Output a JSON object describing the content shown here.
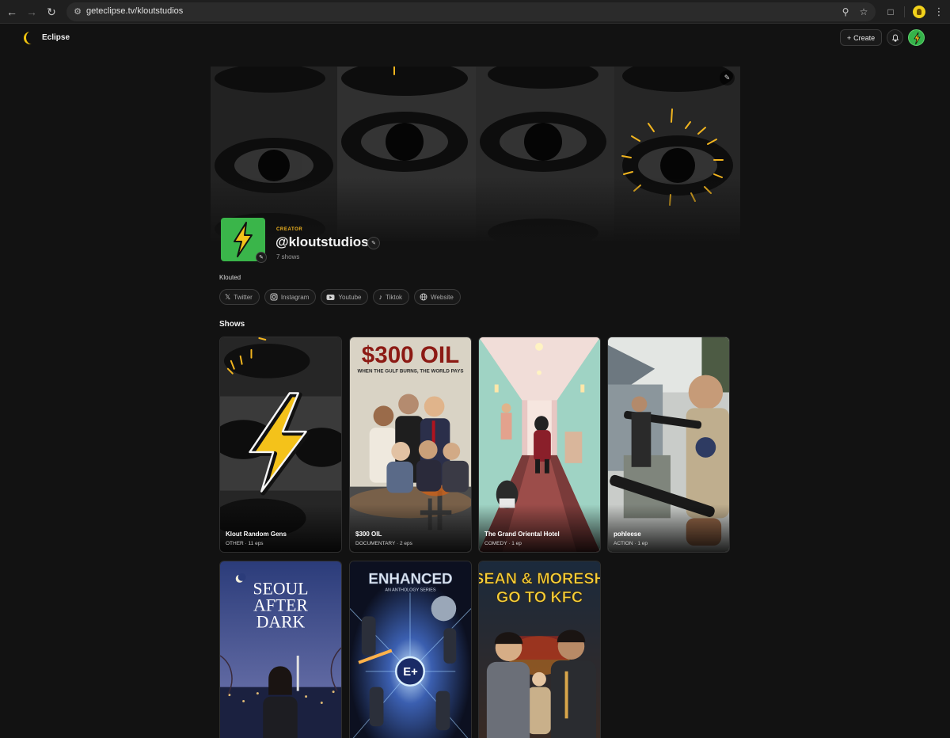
{
  "browser": {
    "url": "geteclipse.tv/kloutstudios"
  },
  "app": {
    "brand_name": "Eclipse",
    "create_label": "Create"
  },
  "profile": {
    "role": "CREATOR",
    "handle": "@kloutstudios",
    "show_count": "7 shows",
    "bio": "Klouted"
  },
  "socials": [
    {
      "label": "Twitter",
      "icon": "x-icon"
    },
    {
      "label": "Instagram",
      "icon": "instagram-icon"
    },
    {
      "label": "Youtube",
      "icon": "youtube-icon"
    },
    {
      "label": "Tiktok",
      "icon": "tiktok-icon"
    },
    {
      "label": "Website",
      "icon": "globe-icon"
    }
  ],
  "shows_section": {
    "title": "Shows"
  },
  "shows": [
    {
      "title": "Klout Random Gens",
      "meta": "OTHER · 11 eps"
    },
    {
      "title": "$300 OIL",
      "meta": "DOCUMENTARY · 2 eps",
      "poster_title": "$300 OIL",
      "poster_tagline": "WHEN THE GULF BURNS, THE WORLD PAYS"
    },
    {
      "title": "The Grand Oriental Hotel",
      "meta": "COMEDY · 1 ep"
    },
    {
      "title": "pohleese",
      "meta": "ACTION · 1 ep"
    },
    {
      "poster_line1": "SEOUL",
      "poster_line2": "AFTER",
      "poster_line3": "DARK"
    },
    {
      "poster_title": "ENHANCED",
      "poster_tagline": "AN ANTHOLOGY SERIES",
      "poster_badge": "E+"
    },
    {
      "poster_line1": "SEAN & MORESH",
      "poster_line2": "GO TO KFC"
    }
  ],
  "colors": {
    "background": "#121212",
    "accent": "#f2b51f",
    "avatar_green": "#3ab54a"
  }
}
